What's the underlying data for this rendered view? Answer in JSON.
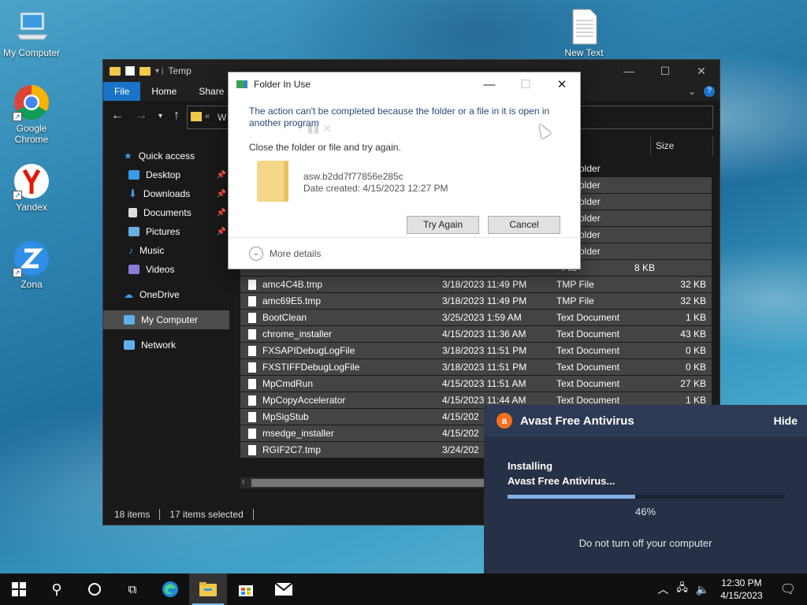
{
  "desktop": {
    "icons": [
      {
        "label": "My Computer",
        "icon": "monitor-icon"
      },
      {
        "label": "Google Chrome",
        "icon": "chrome-icon"
      },
      {
        "label": "Yandex",
        "icon": "yandex-icon"
      },
      {
        "label": "Zona",
        "icon": "zona-icon"
      },
      {
        "label": "New Text",
        "icon": "text-document-icon"
      }
    ]
  },
  "explorer": {
    "title": "Temp",
    "ribbon_tabs": [
      "File",
      "Home",
      "Share"
    ],
    "address_fragment": "W",
    "column_size": "Size",
    "nav": [
      {
        "label": "Quick access"
      },
      {
        "label": "Desktop"
      },
      {
        "label": "Downloads"
      },
      {
        "label": "Documents"
      },
      {
        "label": "Pictures"
      },
      {
        "label": "Music"
      },
      {
        "label": "Videos"
      },
      {
        "label": "OneDrive"
      },
      {
        "label": "My Computer"
      },
      {
        "label": "Network"
      }
    ],
    "folder_rows_type": "older",
    "files": [
      {
        "name": "amc4C4B.tmp",
        "date": "3/18/2023 11:49 PM",
        "type": "TMP File",
        "size": "32 KB"
      },
      {
        "name": "amc69E5.tmp",
        "date": "3/18/2023 11:49 PM",
        "type": "TMP File",
        "size": "32 KB"
      },
      {
        "name": "BootClean",
        "date": "3/25/2023 1:59 AM",
        "type": "Text Document",
        "size": "1 KB"
      },
      {
        "name": "chrome_installer",
        "date": "4/15/2023 11:36 AM",
        "type": "Text Document",
        "size": "43 KB"
      },
      {
        "name": "FXSAPIDebugLogFile",
        "date": "3/18/2023 11:51 PM",
        "type": "Text Document",
        "size": "0 KB"
      },
      {
        "name": "FXSTIFFDebugLogFile",
        "date": "3/18/2023 11:51 PM",
        "type": "Text Document",
        "size": "0 KB"
      },
      {
        "name": "MpCmdRun",
        "date": "4/15/2023 11:51 AM",
        "type": "Text Document",
        "size": "27 KB"
      },
      {
        "name": "MpCopyAccelerator",
        "date": "4/15/2023 11:44 AM",
        "type": "Text Document",
        "size": "1 KB"
      },
      {
        "name": "MpSigStub",
        "date": "4/15/202",
        "type": "",
        "size": ""
      },
      {
        "name": "msedge_installer",
        "date": "4/15/202",
        "type": "",
        "size": ""
      },
      {
        "name": "RGIF2C7.tmp",
        "date": "3/24/202",
        "type": "",
        "size": ""
      }
    ],
    "partial_row": {
      "type": "File",
      "size": "8 KB"
    },
    "status_items": "18 items",
    "status_selected": "17 items selected"
  },
  "dialog": {
    "title": "Folder In Use",
    "message": "The action can't be completed because the folder or a file in it is open in another program",
    "instruction": "Close the folder or file and try again.",
    "file_name": "asw.b2dd7f77856e285c",
    "date_created": "Date created: 4/15/2023 12:27 PM",
    "try_again": "Try Again",
    "cancel": "Cancel",
    "more_details": "More details"
  },
  "avast": {
    "title": "Avast Free Antivirus",
    "hide": "Hide",
    "installing_line1": "Installing",
    "installing_line2": "Avast Free Antivirus...",
    "progress": 0.46,
    "progress_label": "46%",
    "note": "Do not turn off your computer"
  },
  "taskbar": {
    "time": "12:30 PM",
    "date": "4/15/2023"
  },
  "colors": {
    "accent": "#1a73c7",
    "avast_bg": "#2e3a54",
    "avast_orange": "#f37021"
  }
}
